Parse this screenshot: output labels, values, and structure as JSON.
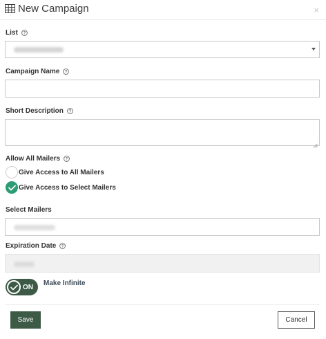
{
  "modal": {
    "title": "New Campaign",
    "title_icon": "table-grid-icon",
    "close_glyph": "×"
  },
  "form": {
    "list": {
      "label": "List",
      "value": ""
    },
    "campaign_name": {
      "label": "Campaign Name",
      "value": ""
    },
    "short_description": {
      "label": "Short Description",
      "value": ""
    },
    "allow_all_mailers": {
      "label": "Allow All Mailers",
      "options": [
        {
          "label": "Give Access to All Mailers",
          "checked": false
        },
        {
          "label": "Give Access to Select Mailers",
          "checked": true
        }
      ]
    },
    "select_mailers": {
      "label": "Select Mailers",
      "value": ""
    },
    "expiration_date": {
      "label": "Expiration Date",
      "value": "",
      "disabled": true
    },
    "make_infinite": {
      "toggle_text": "ON",
      "label": "Make Infinite",
      "on": true
    }
  },
  "footer": {
    "save_label": "Save",
    "cancel_label": "Cancel"
  },
  "colors": {
    "primary": "#3d5a47",
    "radio_checked": "#2b9c74"
  }
}
